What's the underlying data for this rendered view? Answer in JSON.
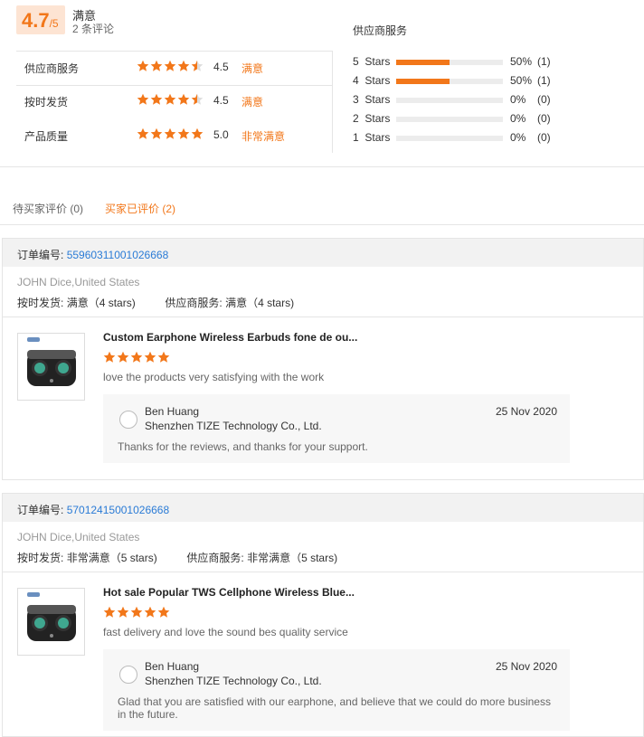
{
  "summary": {
    "score": "4.7",
    "score_max": "/5",
    "satisfaction": "满意",
    "review_count": "2 条评论",
    "ratings": [
      {
        "label": "供应商服务",
        "value": "4.5",
        "text": "满意",
        "stars": 4.5
      },
      {
        "label": "按时发货",
        "value": "4.5",
        "text": "满意",
        "stars": 4.5
      },
      {
        "label": "产品质量",
        "value": "5.0",
        "text": "非常满意",
        "stars": 5
      }
    ],
    "breakdown_title": "供应商服务",
    "breakdown": [
      {
        "num": "5",
        "label": "Stars",
        "fraction": 0.5,
        "pct": "50%",
        "count": "(1)"
      },
      {
        "num": "4",
        "label": "Stars",
        "fraction": 0.5,
        "pct": "50%",
        "count": "(1)"
      },
      {
        "num": "3",
        "label": "Stars",
        "fraction": 0,
        "pct": "0%",
        "count": "(0)"
      },
      {
        "num": "2",
        "label": "Stars",
        "fraction": 0,
        "pct": "0%",
        "count": "(0)"
      },
      {
        "num": "1",
        "label": "Stars",
        "fraction": 0,
        "pct": "0%",
        "count": "(0)"
      }
    ]
  },
  "tabs": [
    {
      "label": "待买家评价 (0)",
      "active": false
    },
    {
      "label": "买家已评价 (2)",
      "active": true
    }
  ],
  "colors": {
    "accent": "#f2771a",
    "link": "#2a7bd6",
    "star_empty": "#dddddd"
  },
  "reviews": [
    {
      "order_label": "订单编号:",
      "order_no": "55960311001026668",
      "buyer": "JOHN Dice,United States",
      "ship_label": "按时发货:",
      "ship_value": "满意（4 stars)",
      "service_label": "供应商服务:",
      "service_value": "满意（4 stars)",
      "product_title": "Custom Earphone Wireless Earbuds fone de ou...",
      "stars": 5,
      "comment": "love the products very satisfying with the work",
      "reply": {
        "name": "Ben Huang",
        "company": "Shenzhen TIZE Technology Co., Ltd.",
        "date": "25 Nov 2020",
        "text": "Thanks for the reviews, and thanks for your support."
      }
    },
    {
      "order_label": "订单编号:",
      "order_no": "57012415001026668",
      "buyer": "JOHN Dice,United States",
      "ship_label": "按时发货:",
      "ship_value": "非常满意（5 stars)",
      "service_label": "供应商服务:",
      "service_value": "非常满意（5 stars)",
      "product_title": "Hot sale Popular TWS Cellphone Wireless Blue...",
      "stars": 5,
      "comment": "fast delivery and love the sound bes quality service",
      "reply": {
        "name": "Ben Huang",
        "company": "Shenzhen TIZE Technology Co., Ltd.",
        "date": "25 Nov 2020",
        "text": "Glad that you are satisfied with our earphone, and believe that we could do more business in the future."
      }
    }
  ]
}
